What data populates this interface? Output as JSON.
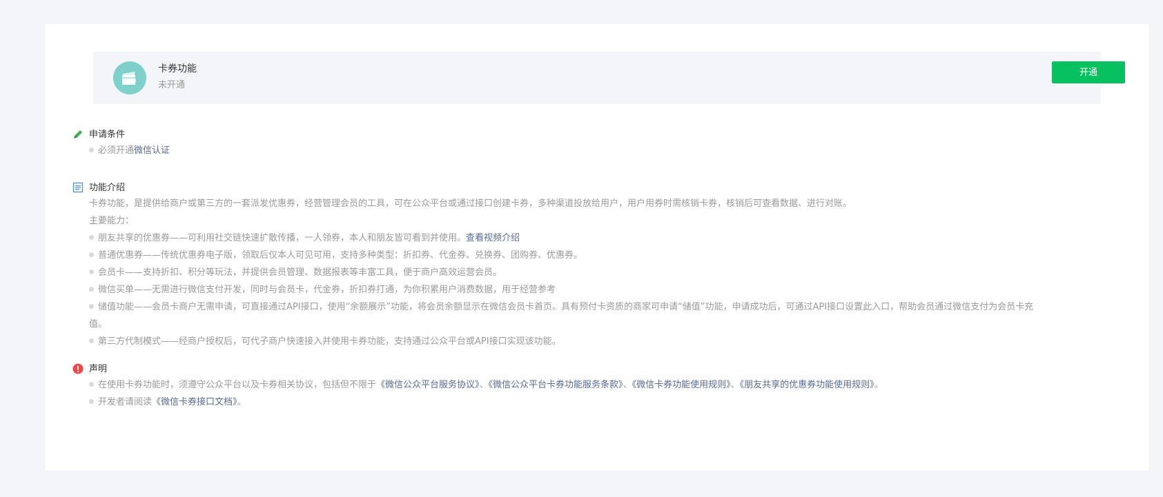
{
  "banner": {
    "title": "卡券功能",
    "status": "未开通",
    "button_label": "开通",
    "icon": "card-icon"
  },
  "conditions": {
    "title": "申请条件",
    "icon": "pencil-icon",
    "item_prefix": "必须开通",
    "item_link": "微信认证"
  },
  "intro": {
    "title": "功能介绍",
    "icon": "document-icon",
    "description": "卡券功能，是提供给商户或第三方的一套派发优惠券，经营管理会员的工具，可在公众平台或通过接口创建卡券，多种渠道投放给用户，用户用券时需核销卡券，核销后可查看数据、进行对账。",
    "main_label": "主要能力：",
    "item1_text": "朋友共享的优惠券——可利用社交链快速扩散传播，一人领券，本人和朋友皆可看到并使用。",
    "item1_link": "查看视频介绍",
    "item2": "普通优惠券——传统优惠券电子版，领取后仅本人可见可用，支持多种类型：折扣券、代金券、兑换券、团购券、优惠券。",
    "item3": "会员卡——支持折扣、积分等玩法，并提供会员管理、数据报表等丰富工具，便于商户高效运营会员。",
    "item4": "微信买单——无需进行微信支付开发，同时与会员卡，代金券，折扣券打通，为你积累用户消费数据，用于经营参考",
    "item5_line1": "储值功能——会员卡商户无需申请，可直接通过API接口，使用“余额展示”功能，将会员余额显示在微信会员卡首页。具有预付卡资质的商家可申请“储值”功能，申请成功后，可通过API接口设置此入口，帮助会员通过微信支付为会员卡充",
    "item5_line2": "值。",
    "item6": "第三方代制模式——经商户授权后，可代子商户快速接入并使用卡券功能，支持通过公众平台或API接口实现该功能。"
  },
  "statement": {
    "title": "声明",
    "icon": "warning-icon",
    "line1_prefix": "在使用卡券功能时，须遵守公众平台以及卡券相关协议，包括但不限于",
    "link1": "《微信公众平台服务协议》",
    "sep1": "、",
    "link2": "《微信公众平台卡券功能服务条款》",
    "sep2": "、",
    "link3": "《微信卡券功能使用规则》",
    "sep3": "、",
    "link4": "《朋友共享的优惠券功能使用规则》",
    "end1": "。",
    "line2_prefix": "开发者请阅读",
    "link5": "《微信卡券接口文档》",
    "end2": "。"
  },
  "colors": {
    "accent_green": "#07c160",
    "link": "#576b95",
    "warning_red": "#f04848",
    "icon_teal": "#7fd0cb"
  }
}
